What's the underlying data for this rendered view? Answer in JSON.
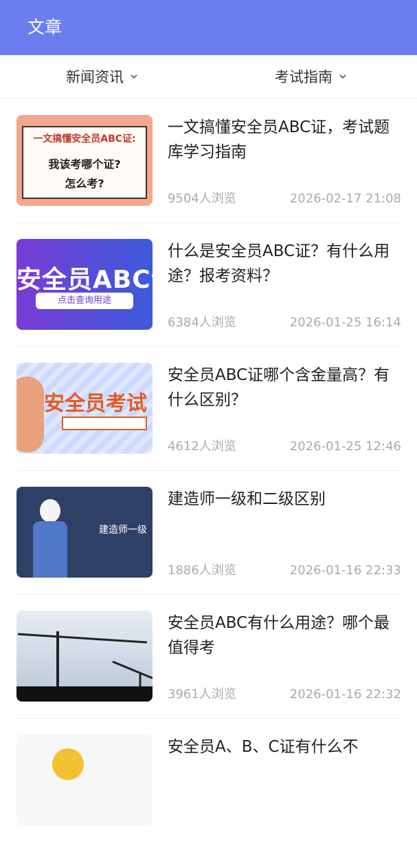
{
  "header": {
    "title": "文章"
  },
  "filters": {
    "left": "新闻资讯",
    "right": "考试指南"
  },
  "articles": [
    {
      "title": "一文搞懂安全员ABC证，考试题库学习指南",
      "views": "9504人浏览",
      "date": "2026-02-17 21:08",
      "thumb": {
        "l1": "一文搞懂安全员ABC证:",
        "l2": "我该考哪个证?",
        "l3": "怎么考?"
      }
    },
    {
      "title": "什么是安全员ABC证？有什么用途？报考资料？",
      "views": "6384人浏览",
      "date": "2026-01-25 16:14",
      "thumb": {
        "big": "安全员ABC证",
        "pill": "点击查询用途"
      }
    },
    {
      "title": "安全员ABC证哪个含金量高？有什么区别？",
      "views": "4612人浏览",
      "date": "2026-01-25 12:46",
      "thumb": {
        "big": "安全员考试"
      }
    },
    {
      "title": "建造师一级和二级区别",
      "views": "1886人浏览",
      "date": "2026-01-16 22:33",
      "thumb": {
        "label": "建造师一级"
      }
    },
    {
      "title": "安全员ABC有什么用途？哪个最值得考",
      "views": "3961人浏览",
      "date": "2026-01-16 22:32",
      "thumb": {}
    },
    {
      "title": "安全员A、B、C证有什么不",
      "views": "",
      "date": "",
      "thumb": {}
    }
  ]
}
